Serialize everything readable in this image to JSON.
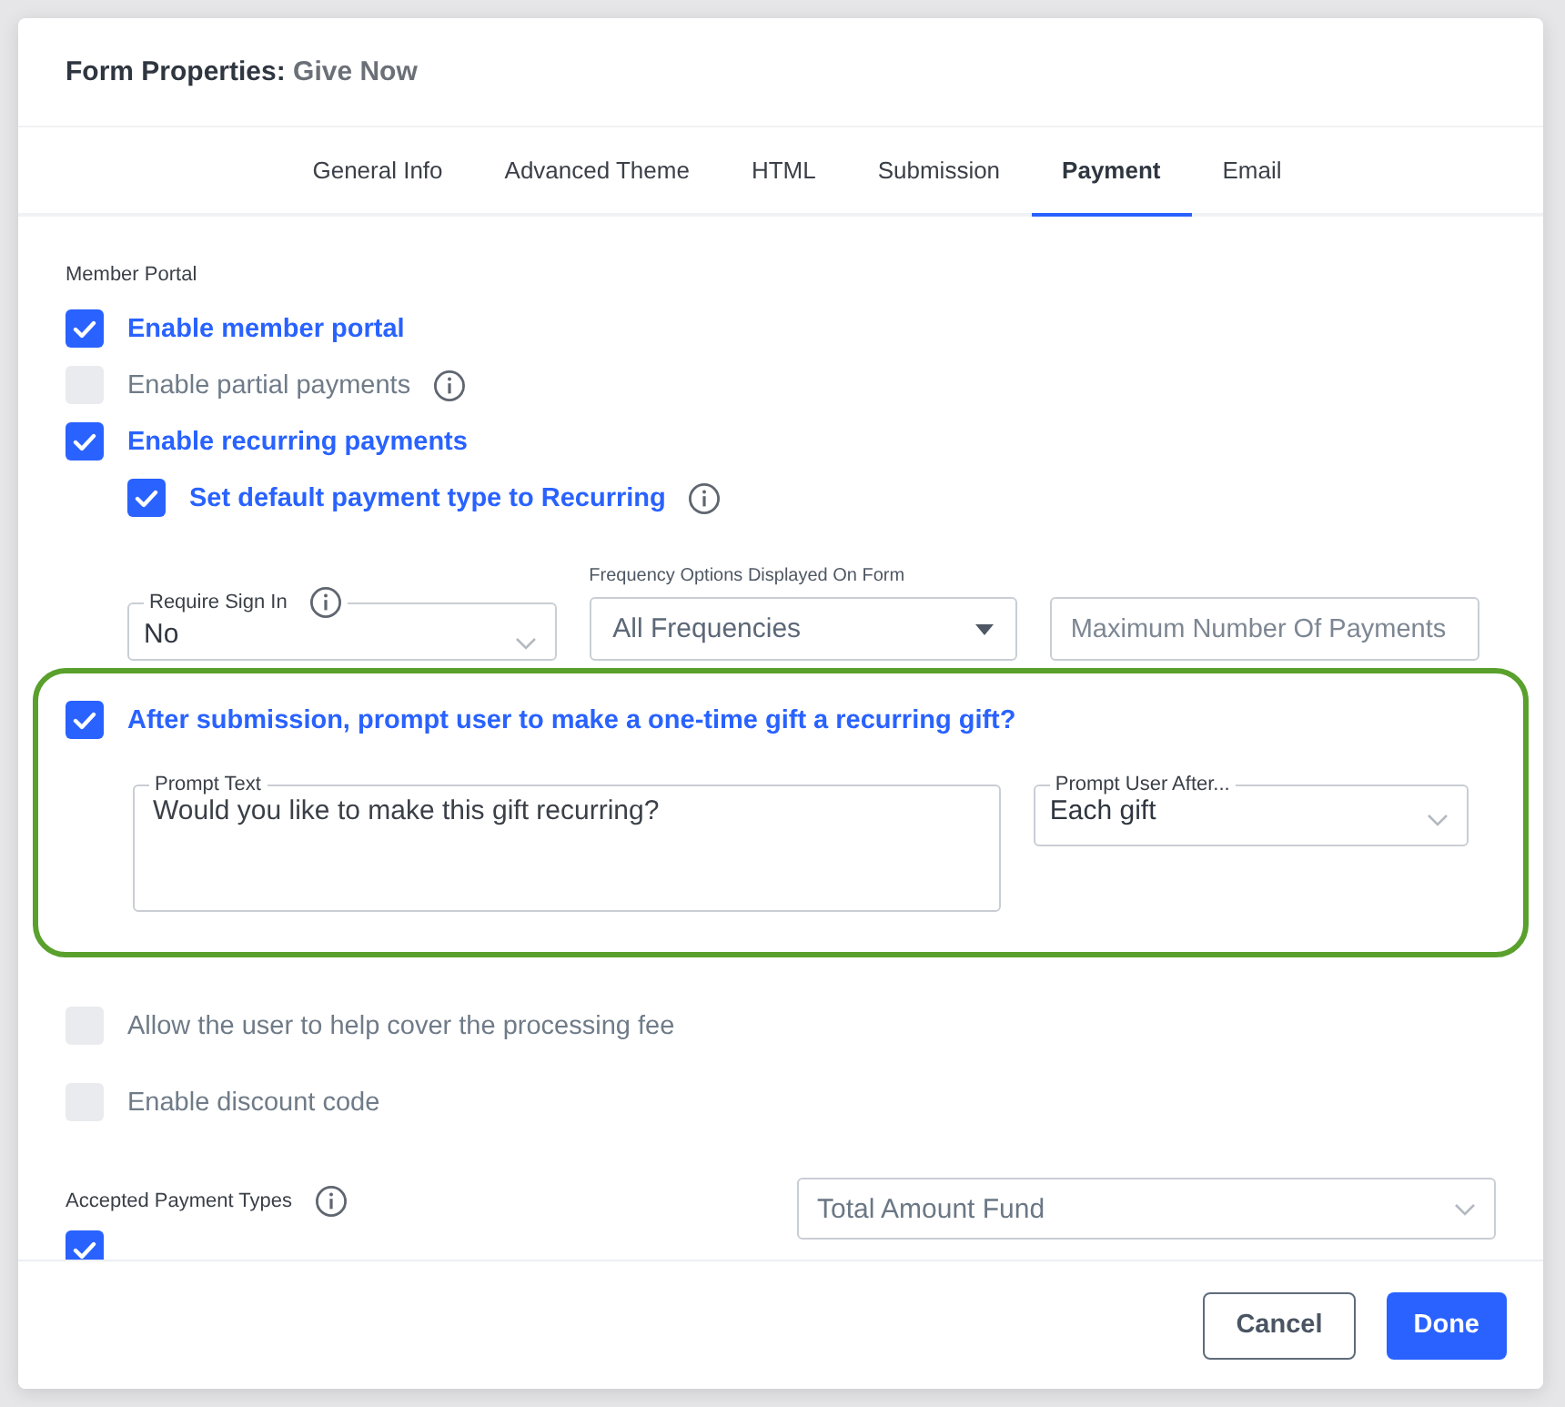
{
  "dialog": {
    "title_prefix": "Form Properties:",
    "title_name": "Give Now"
  },
  "tabs": [
    {
      "label": "General Info",
      "selected": false
    },
    {
      "label": "Advanced Theme",
      "selected": false
    },
    {
      "label": "HTML",
      "selected": false
    },
    {
      "label": "Submission",
      "selected": false
    },
    {
      "label": "Payment",
      "selected": true
    },
    {
      "label": "Email",
      "selected": false
    }
  ],
  "member_portal": {
    "heading": "Member Portal",
    "options": [
      {
        "label": "Enable member portal",
        "checked": true
      },
      {
        "label": "Enable partial payments",
        "checked": false,
        "info": true
      },
      {
        "label": "Enable recurring payments",
        "checked": true,
        "children": [
          {
            "label": "Set default payment type to Recurring",
            "checked": true,
            "info": true
          }
        ]
      }
    ]
  },
  "recurring_fields": [
    {
      "kind": "outlined-select",
      "label": "Require Sign In",
      "info": true,
      "value": "No"
    },
    {
      "kind": "filled-select",
      "label": "Frequency Options Displayed On Form",
      "value": "All Frequencies"
    },
    {
      "kind": "text-input",
      "placeholder": "Maximum Number Of Payments"
    }
  ],
  "recurring_prompt": {
    "checked": true,
    "label": "After submission, prompt user to make a one-time gift a recurring gift?",
    "prompt_text": {
      "label": "Prompt Text",
      "value": "Would you like to make this gift recurring?"
    },
    "prompt_after": {
      "label": "Prompt User After...",
      "value": "Each gift"
    }
  },
  "more_options": [
    {
      "label": "Allow the user to help cover the processing fee",
      "checked": false
    },
    {
      "label": "Enable discount code",
      "checked": false
    }
  ],
  "payment_types": {
    "heading": "Accepted Payment Types",
    "info": true,
    "fund_select": {
      "value": "Total Amount Fund"
    },
    "options": [
      {
        "checked": true
      }
    ]
  },
  "buttons": [
    {
      "label": "Cancel",
      "kind": "secondary"
    },
    {
      "label": "Done",
      "kind": "primary"
    }
  ]
}
